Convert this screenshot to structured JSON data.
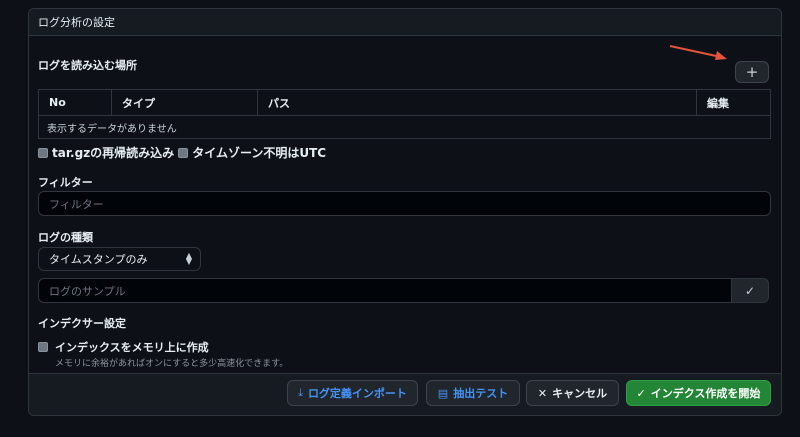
{
  "panel": {
    "title": "ログ分析の設定"
  },
  "log_location": {
    "label": "ログを読み込む場所",
    "add_button": "+",
    "columns": [
      "No",
      "タイプ",
      "パス",
      "編集"
    ],
    "empty_text": "表示するデータがありません"
  },
  "options": {
    "reread_targz": "tar.gzの再帰読み込み",
    "timezone_utc": "タイムゾーン不明はUTC"
  },
  "filter": {
    "label": "フィルター",
    "placeholder": "フィルター"
  },
  "log_type": {
    "label": "ログの種類",
    "selected": "タイムスタンプのみ",
    "sample_placeholder": "ログのサンプル"
  },
  "indexer": {
    "label": "インデクサー設定",
    "in_memory_label": "インデックスをメモリ上に作成",
    "in_memory_hint": "メモリに余裕があればオンにすると多少高速化できます。"
  },
  "footer": {
    "import_label": "ログ定義インポート",
    "extract_test_label": "抽出テスト",
    "cancel_label": "キャンセル",
    "start_label": "インデクス作成を開始"
  },
  "colors": {
    "background": "#0d1117",
    "panel_header": "#161b22",
    "border": "#30363d",
    "accent_blue": "#4493f8",
    "primary_green": "#238636",
    "annotation_arrow": "#e5533d"
  },
  "icons": {
    "import": "download-icon",
    "extract_test": "file-icon",
    "cancel": "x-icon",
    "start": "check-icon",
    "sample_check": "check-icon",
    "select": "updown-icon"
  }
}
